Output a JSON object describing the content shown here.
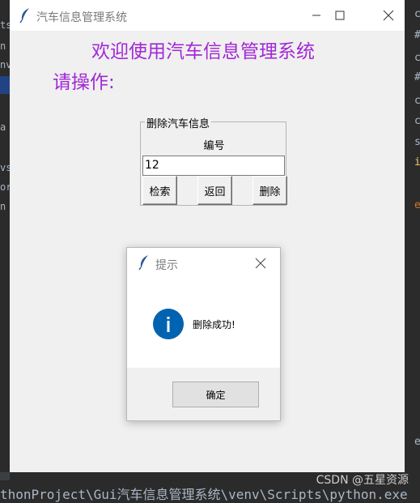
{
  "background": {
    "left_fragments": [
      "ts",
      "n",
      "nv",
      "a",
      "vs",
      "or",
      "n"
    ],
    "right_fragments": [
      "c",
      "#",
      "c",
      "#",
      "c",
      "c",
      "s",
      "i",
      "e",
      "e"
    ],
    "bottom_path": "thonProject\\Gui汽车信息管理系统\\venv\\Scripts\\python.exe",
    "watermark": "CSDN @五星资源"
  },
  "window": {
    "title": "汽车信息管理系统",
    "welcome": "欢迎使用汽车信息管理系统",
    "prompt": "请操作:",
    "group_title": "删除汽车信息",
    "field_label": "编号",
    "field_value": "12",
    "buttons": {
      "search": "检索",
      "back": "返回",
      "delete": "删除"
    }
  },
  "dialog": {
    "title": "提示",
    "message": "删除成功!",
    "ok": "确定"
  },
  "colors": {
    "accent": "#a228d6",
    "info": "#0063b1"
  }
}
